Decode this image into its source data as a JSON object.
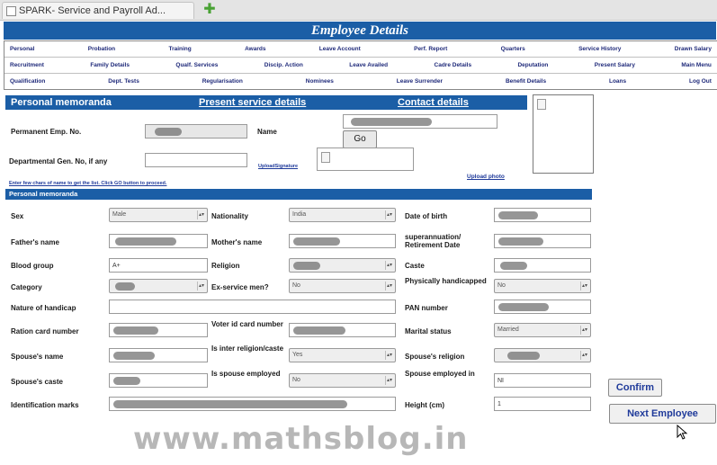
{
  "browser": {
    "tab_title": "SPARK- Service and Payroll Ad..."
  },
  "page_title": "Employee Details",
  "menu": {
    "row1": [
      "Personal",
      "Probation",
      "Training",
      "Awards",
      "Leave Account",
      "Perf. Report",
      "Quarters",
      "Service History",
      "Drawn Salary"
    ],
    "row2": [
      "Recruitment",
      "Family Details",
      "Qualf. Services",
      "Discip. Action",
      "Leave Availed",
      "Cadre Details",
      "Deputation",
      "Present Salary",
      "Main Menu"
    ],
    "row3": [
      "Qualification",
      "Dept. Tests",
      "Regularisation",
      "Nominees",
      "Leave Surrender",
      "Benefit Details",
      "Loans",
      "Log Out"
    ]
  },
  "section": {
    "personal_memoranda": "Personal memoranda",
    "present_service_link": "Present service details",
    "contact_link": "Contact details",
    "subheader": "Personal memoranda"
  },
  "search": {
    "pen_label": "Permanent Emp. No.",
    "name_label": "Name",
    "go_label": "Go",
    "dept_gen_label": "Departmental Gen. No, if any",
    "upload_signature": "UploadSignature",
    "upload_photo": "Upload photo",
    "hint": "Enter few chars of name to get the list. Click GO button to proceed."
  },
  "form": {
    "sex": {
      "label": "Sex",
      "value": "Male"
    },
    "nationality": {
      "label": "Nationality",
      "value": "India"
    },
    "dob": {
      "label": "Date of birth"
    },
    "father": {
      "label": "Father's name"
    },
    "mother": {
      "label": "Mother's name"
    },
    "superannuation": {
      "label": "superannuation/ Retirement Date"
    },
    "blood_group": {
      "label": "Blood group",
      "value": "A+"
    },
    "religion": {
      "label": "Religion"
    },
    "caste": {
      "label": "Caste"
    },
    "category": {
      "label": "Category"
    },
    "ex_service": {
      "label": "Ex-service men?",
      "value": "No"
    },
    "physically_handicapped": {
      "label": "Physically handicapped",
      "value": "No"
    },
    "nature_handicap": {
      "label": "Nature of handicap"
    },
    "pan": {
      "label": "PAN number"
    },
    "ration_card": {
      "label": "Ration card number"
    },
    "voter_id": {
      "label": "Voter id card number"
    },
    "marital_status": {
      "label": "Marital status",
      "value": "Married"
    },
    "spouse_name": {
      "label": "Spouse's name"
    },
    "inter_religion": {
      "label": "Is inter religion/caste",
      "value": "Yes"
    },
    "spouse_religion": {
      "label": "Spouse's religion"
    },
    "spouse_caste": {
      "label": "Spouse's caste"
    },
    "spouse_employed": {
      "label": "Is spouse employed",
      "value": "No"
    },
    "spouse_employed_in": {
      "label": "Spouse employed in",
      "value": "NI"
    },
    "id_marks": {
      "label": "Identification marks"
    },
    "height": {
      "label": "Height (cm)",
      "value": "1"
    }
  },
  "buttons": {
    "confirm": "Confirm",
    "next_employee": "Next Employee"
  },
  "watermark": "www.mathsblog.in",
  "colors": {
    "header_blue": "#1b5ea6",
    "menu_text": "#1f2a7a",
    "link_blue": "#1f3a9a"
  }
}
